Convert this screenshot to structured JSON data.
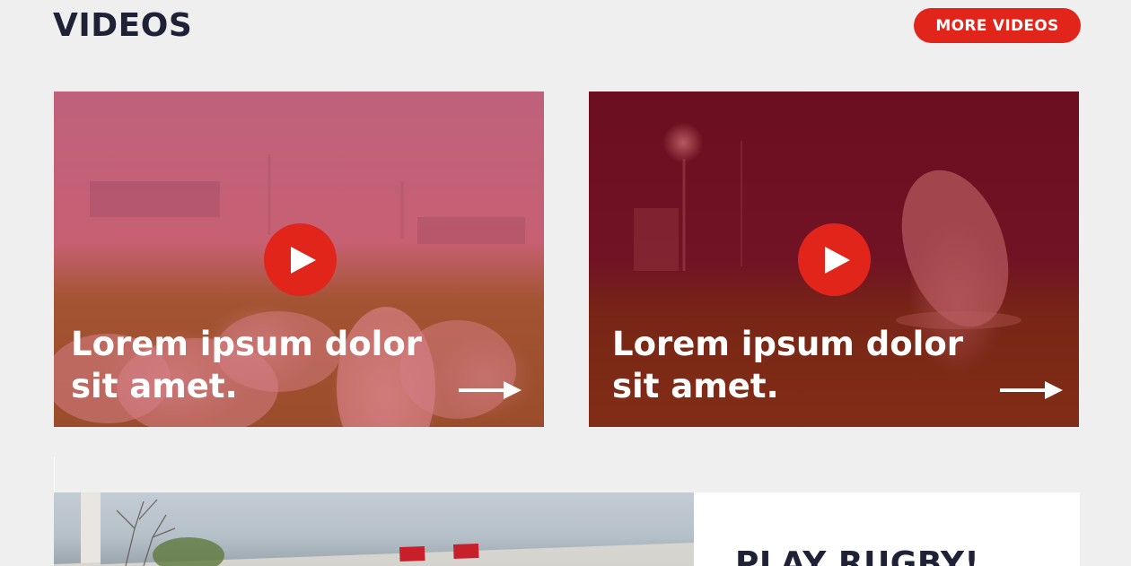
{
  "header": {
    "title": "VIDEOS",
    "more_label": "MORE VIDEOS"
  },
  "cards": [
    {
      "title_line1": "Lorem ipsum dolor",
      "title_line2": "sit amet."
    },
    {
      "title_line1": "Lorem ipsum dolor",
      "title_line2": "sit amet."
    }
  ],
  "promo": {
    "title": "PLAY RUGBY!"
  },
  "colors": {
    "accent": "#e1251b",
    "heading": "#1f2236",
    "background": "#efefef"
  },
  "icons": [
    "play-icon",
    "arrow-right-icon"
  ]
}
